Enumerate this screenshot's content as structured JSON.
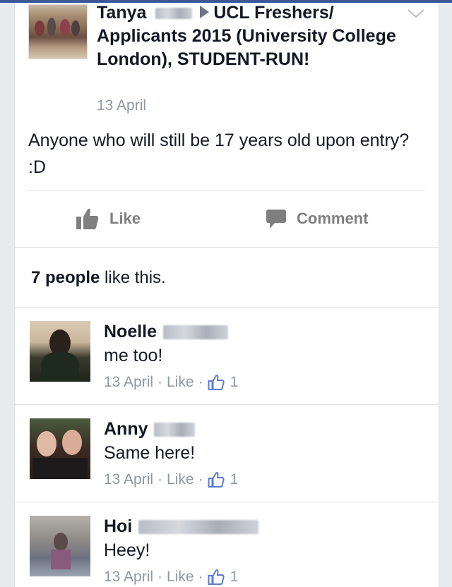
{
  "post": {
    "author": "Tanya",
    "group": "UCL Freshers/ Applicants 2015 (University College London), STUDENT-RUN!",
    "date": "13 April",
    "body": "Anyone who will still be 17 years old upon entry? :D"
  },
  "actions": {
    "like_label": "Like",
    "comment_label": "Comment"
  },
  "likes": {
    "count_text": "7 people",
    "suffix_text": "like this."
  },
  "comments": [
    {
      "name": "Noelle",
      "text": "me too!",
      "date": "13 April",
      "like_label": "Like",
      "like_count": "1"
    },
    {
      "name": "Anny",
      "text": "Same here!",
      "date": "13 April",
      "like_label": "Like",
      "like_count": "1"
    },
    {
      "name": "Hoi",
      "text": "Heey!",
      "date": "13 April",
      "like_label": "Like",
      "like_count": "1"
    }
  ],
  "colors": {
    "brand": "#3b5998",
    "text": "#141823",
    "muted": "#9197a3",
    "action_gray": "#7f7f7f",
    "like_icon_blue": "#5b7bd5"
  },
  "icons": {
    "chevron": "chevron-down-icon",
    "like": "thumbs-up-icon",
    "comment": "speech-bubble-icon",
    "comment_like": "thumbs-up-outline-icon"
  }
}
